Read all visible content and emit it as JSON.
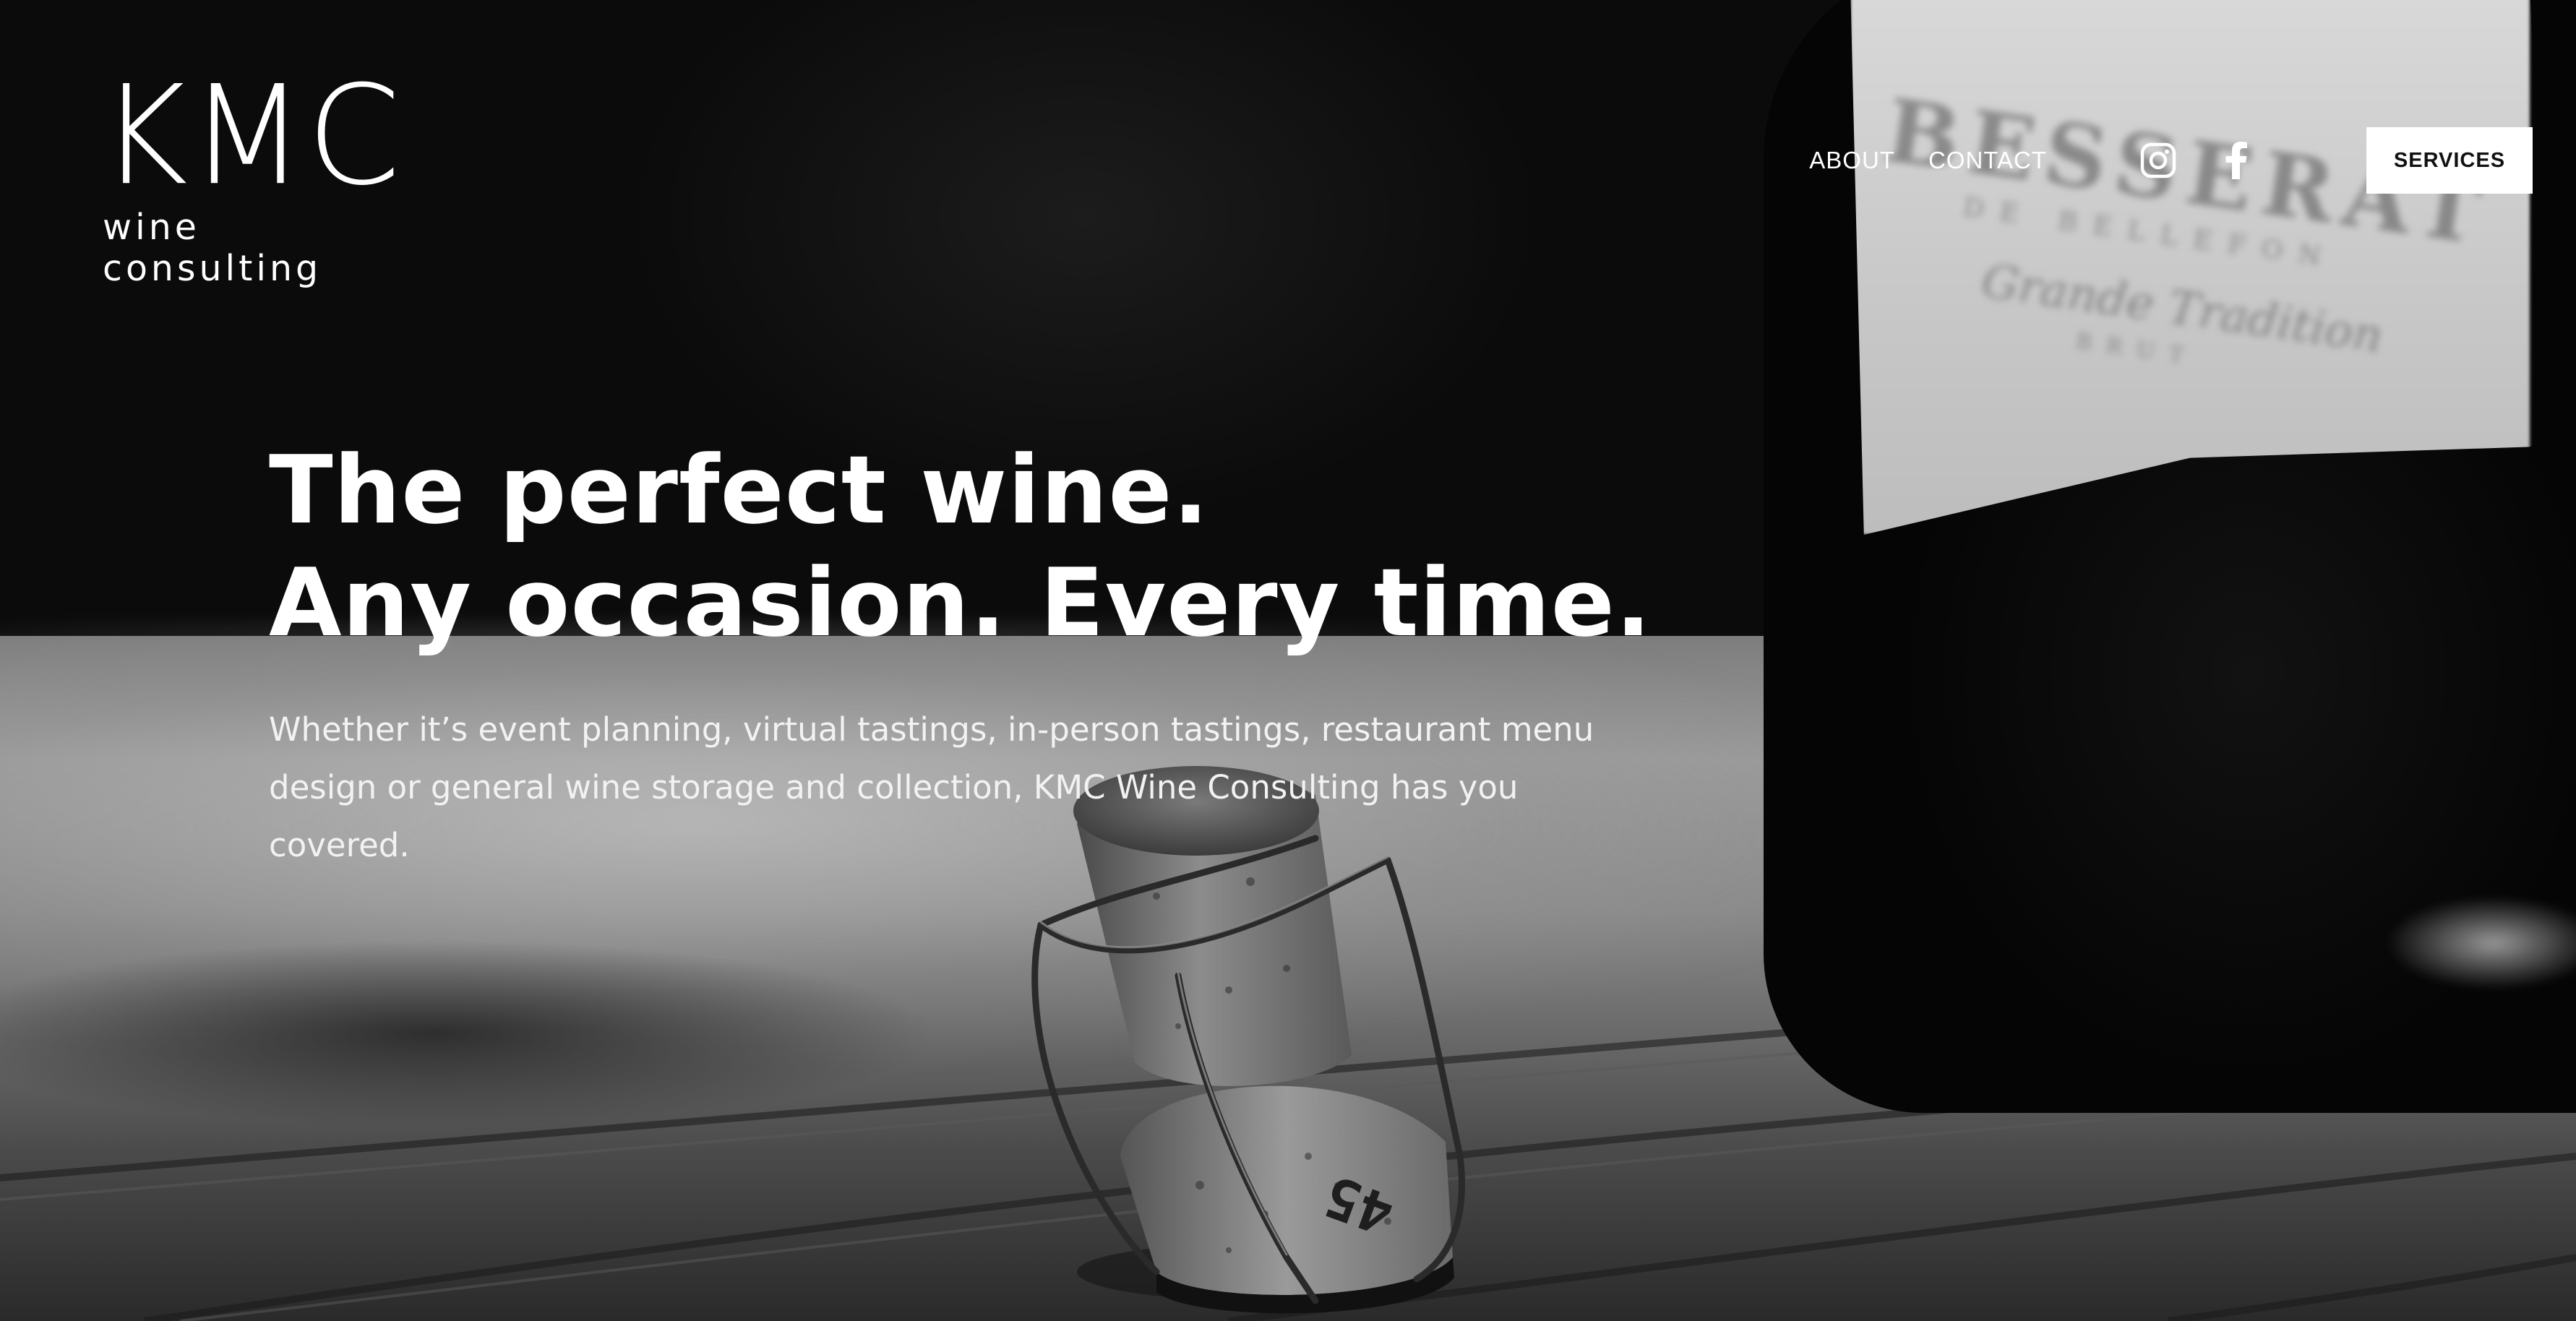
{
  "brand": {
    "name": "KMC",
    "tagline": "wine consulting"
  },
  "nav": {
    "links": [
      "ABOUT",
      "CONTACT"
    ],
    "social": [
      "instagram-icon",
      "facebook-icon"
    ],
    "cta": "SERVICES"
  },
  "hero": {
    "title_line1": "The perfect wine.",
    "title_line2": "Any occasion. Every time.",
    "body": "Whether it’s event planning, virtual tastings, in-person tastings, restaurant menu design or general wine storage and collection, KMC Wine Consulting has you covered."
  },
  "background": {
    "label_line1": "BESSERAT",
    "label_line2": "DE BELLEFON",
    "label_line3": "Grande Tradition",
    "label_line4": "BRUT",
    "cork_number": "45"
  },
  "colors": {
    "text": "#ffffff",
    "button_bg": "#ffffff",
    "button_text": "#111111"
  }
}
